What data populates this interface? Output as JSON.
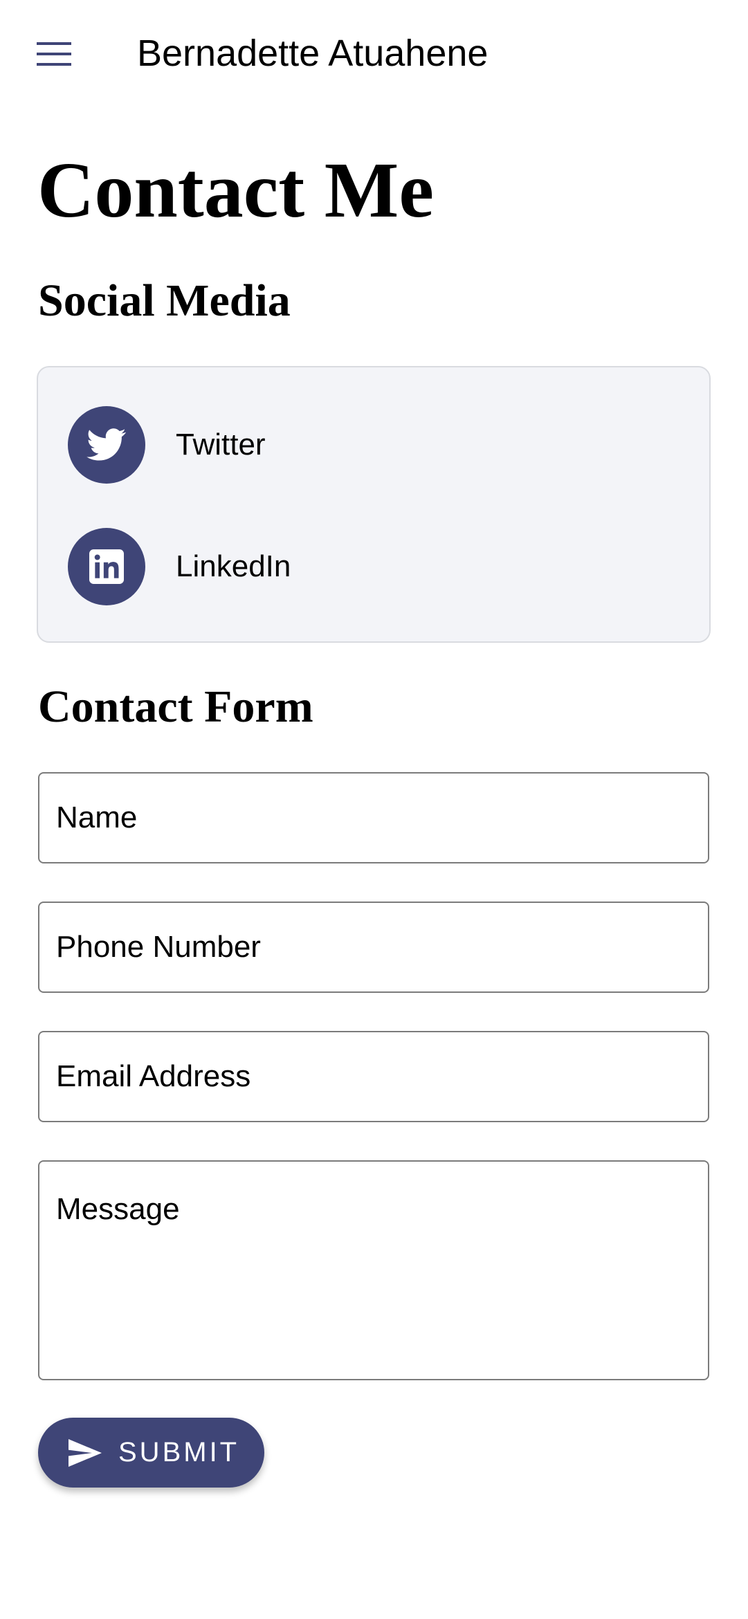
{
  "app_bar": {
    "menu_icon": "hamburger-menu-icon",
    "title": "Bernadette Atuahene"
  },
  "page": {
    "title": "Contact Me"
  },
  "social": {
    "heading": "Social Media",
    "items": [
      {
        "label": "Twitter",
        "icon": "twitter-icon"
      },
      {
        "label": "LinkedIn",
        "icon": "linkedin-icon"
      }
    ]
  },
  "contact_form": {
    "heading": "Contact Form",
    "fields": {
      "name": {
        "placeholder": "Name",
        "value": ""
      },
      "phone": {
        "placeholder": "Phone Number",
        "value": ""
      },
      "email": {
        "placeholder": "Email Address",
        "value": ""
      },
      "message": {
        "placeholder": "Message",
        "value": ""
      }
    },
    "submit_label": "SUBMIT",
    "submit_icon": "send-icon"
  },
  "colors": {
    "accent": "#3f4577",
    "card_background": "#f3f4f8",
    "field_border": "#7b7b7b"
  }
}
